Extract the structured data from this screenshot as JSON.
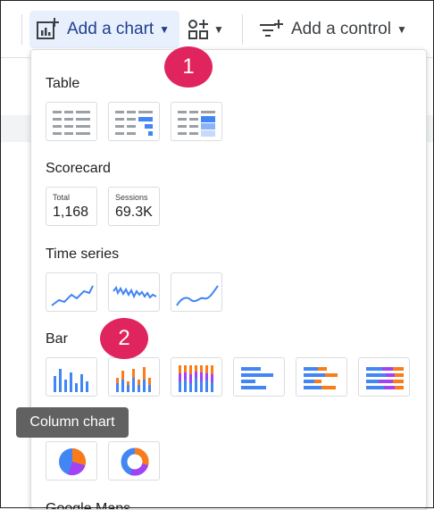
{
  "toolbar": {
    "add_chart_label": "Add a chart",
    "add_control_label": "Add a control"
  },
  "menu": {
    "sections": [
      {
        "title": "Table"
      },
      {
        "title": "Scorecard"
      },
      {
        "title": "Time series"
      },
      {
        "title": "Bar"
      },
      {
        "title": "Google Maps"
      }
    ],
    "scorecards": [
      {
        "label": "Total",
        "value": "1,168"
      },
      {
        "label": "Sessions",
        "value": "69.3K"
      }
    ]
  },
  "badges": [
    "1",
    "2"
  ],
  "tooltip": "Column chart",
  "colors": {
    "accent_blue": "#4285f4",
    "accent_orange": "#fa7b17",
    "accent_purple": "#a142f4",
    "badge_pink": "#e0245e",
    "active_bg": "#e8f0fe"
  },
  "icons": [
    "add-chart-icon",
    "community-viz-icon",
    "add-control-icon"
  ]
}
